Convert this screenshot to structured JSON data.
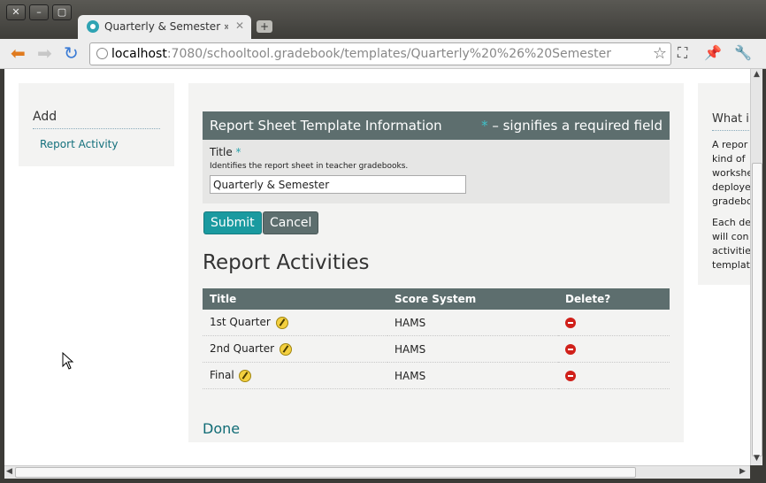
{
  "window": {
    "close_glyph": "✕",
    "min_glyph": "–",
    "max_glyph": "▢"
  },
  "tab": {
    "title": "Quarterly & Semester » Ec",
    "close_glyph": "✕",
    "new_tab_glyph": "+"
  },
  "toolbar": {
    "back_glyph": "⬅",
    "forward_glyph": "➡",
    "reload_glyph": "↻",
    "url_host": "localhost",
    "url_rest": ":7080/schooltool.gradebook/templates/Quarterly%20%26%20Semester",
    "star_glyph": "☆",
    "fullscreen_glyph": "⛶",
    "pin_glyph": "📌",
    "wrench_glyph": "🔧"
  },
  "sidebar": {
    "heading": "Add",
    "link": "Report Activity"
  },
  "form": {
    "header_title": "Report Sheet Template Information",
    "required_asterisk": "*",
    "required_note": " – signifies a required field",
    "title_label": "Title",
    "title_asterisk": "*",
    "title_hint": "Identifies the report sheet in teacher gradebooks.",
    "title_value": "Quarterly & Semester",
    "submit_label": "Submit",
    "cancel_label": "Cancel"
  },
  "activities": {
    "heading": "Report Activities",
    "columns": [
      "Title",
      "Score System",
      "Delete?"
    ],
    "rows": [
      {
        "title": "1st Quarter",
        "score_system": "HAMS"
      },
      {
        "title": "2nd Quarter",
        "score_system": "HAMS"
      },
      {
        "title": "Final",
        "score_system": "HAMS"
      }
    ],
    "done_label": "Done"
  },
  "right_panel": {
    "heading": "What i",
    "para1_lines": [
      "A repor",
      "kind of",
      "workshe",
      "deploye",
      "gradebo"
    ],
    "para2_lines": [
      "Each de",
      "will con",
      "activitie",
      "templat"
    ]
  },
  "colors": {
    "accent": "#1a9aa0",
    "header_bg": "#5d6e6e",
    "link": "#13707c"
  }
}
